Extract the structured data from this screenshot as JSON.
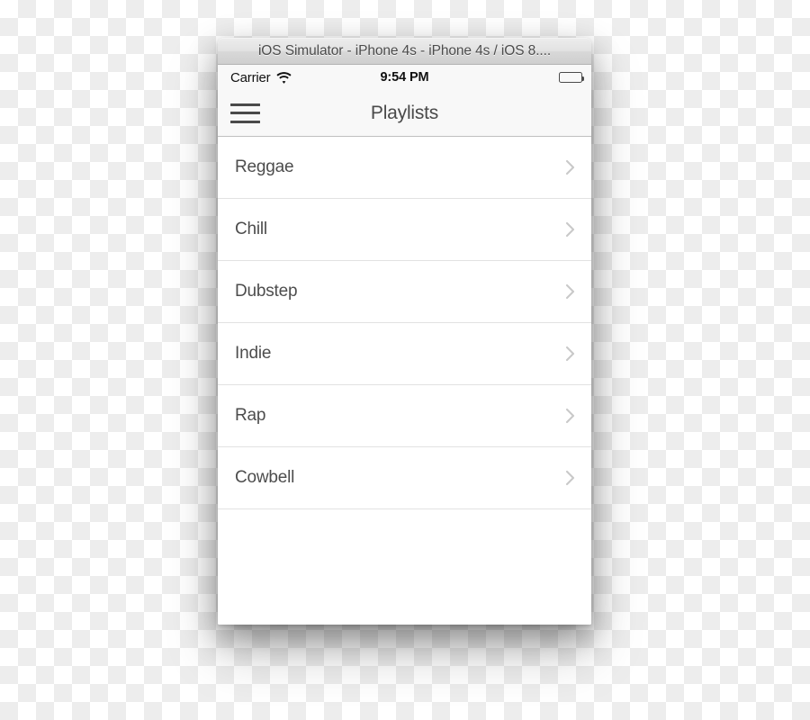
{
  "window": {
    "titlebar_text": "iOS Simulator - iPhone 4s - iPhone 4s / iOS 8...."
  },
  "status_bar": {
    "carrier": "Carrier",
    "wifi_icon": "wifi-icon",
    "time": "9:54 PM",
    "battery_icon": "battery-full-icon"
  },
  "nav_bar": {
    "menu_icon": "hamburger-menu-icon",
    "title": "Playlists"
  },
  "list": {
    "rows": [
      {
        "label": "Reggae",
        "accessory": "chevron-right-icon"
      },
      {
        "label": "Chill",
        "accessory": "chevron-right-icon"
      },
      {
        "label": "Dubstep",
        "accessory": "chevron-right-icon"
      },
      {
        "label": "Indie",
        "accessory": "chevron-right-icon"
      },
      {
        "label": "Rap",
        "accessory": "chevron-right-icon"
      },
      {
        "label": "Cowbell",
        "accessory": "chevron-right-icon"
      }
    ]
  },
  "colors": {
    "chrome": "#f8f8f8",
    "separator": "#e2e2e2",
    "text": "#4d4d4d",
    "chevron": "#c9c9c9"
  }
}
